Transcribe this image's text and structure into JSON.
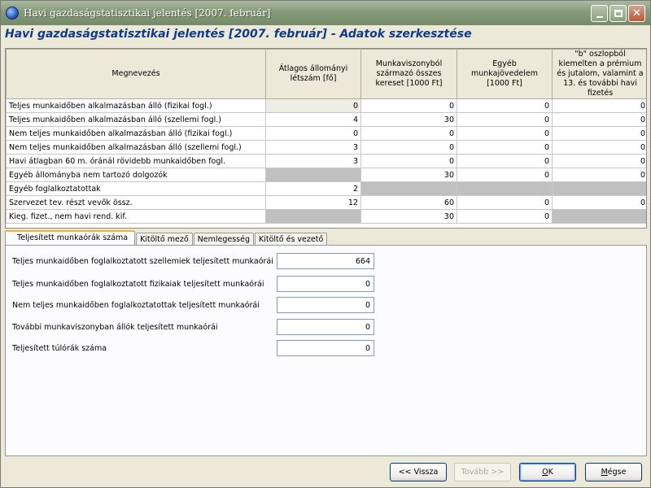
{
  "window": {
    "title": "Havi gazdaságstatisztikai jelentés [2007. február]"
  },
  "header": {
    "title": "Havi gazdaságstatisztikai jelentés [2007. február] - Adatok szerkesztése"
  },
  "grid": {
    "columns": [
      "Megnevezés",
      "Átlagos állományi létszám [fő]",
      "Munkaviszonyból származó összes kereset [1000 Ft]",
      "Egyéb munkajövedelem [1000 Ft]",
      "\"b\" oszlopból kiemelten a prémium és jutalom, valamint a 13. és további havi fizetés"
    ],
    "rows": [
      {
        "label": "Teljes munkaidőben alkalmazásban álló (fizikai fogl.)",
        "cells": [
          "0",
          "0",
          "0",
          "0"
        ],
        "gray": [
          false,
          false,
          false,
          false
        ]
      },
      {
        "label": "Teljes munkaidőben alkalmazásban álló (szellemi fogl.)",
        "cells": [
          "4",
          "30",
          "0",
          "0"
        ],
        "gray": [
          false,
          false,
          false,
          false
        ]
      },
      {
        "label": "Nem teljes munkaidőben alkalmazásban álló (fizikai fogl.)",
        "cells": [
          "0",
          "0",
          "0",
          "0"
        ],
        "gray": [
          false,
          false,
          false,
          false
        ]
      },
      {
        "label": "Nem teljes munkaidőben alkalmazásban álló (szellemi fogl.)",
        "cells": [
          "3",
          "0",
          "0",
          "0"
        ],
        "gray": [
          false,
          false,
          false,
          false
        ]
      },
      {
        "label": "Havi átlagban 60 m. óránál rövidebb munkaidőben fogl.",
        "cells": [
          "3",
          "0",
          "0",
          "0"
        ],
        "gray": [
          false,
          false,
          false,
          false
        ]
      },
      {
        "label": "Egyéb állományba nem tartozó dolgozók",
        "cells": [
          "",
          "30",
          "0",
          "0"
        ],
        "gray": [
          true,
          false,
          false,
          false
        ]
      },
      {
        "label": "Egyéb foglalkoztatottak",
        "cells": [
          "2",
          "",
          "",
          ""
        ],
        "gray": [
          false,
          true,
          true,
          true
        ]
      },
      {
        "label": "Szervezet tev. részt vevők össz.",
        "cells": [
          "12",
          "60",
          "0",
          "0"
        ],
        "gray": [
          false,
          false,
          false,
          false
        ]
      },
      {
        "label": "Kieg. fizet., nem havi rend. kif.",
        "cells": [
          "",
          "30",
          "0",
          ""
        ],
        "gray": [
          true,
          false,
          false,
          true
        ]
      }
    ]
  },
  "tabs": [
    {
      "label": "Teljesített munkaórák száma",
      "active": true
    },
    {
      "label": "Kitöltő mező",
      "active": false
    },
    {
      "label": "Nemlegesség",
      "active": false
    },
    {
      "label": "Kitöltő és vezető",
      "active": false
    }
  ],
  "form": {
    "fields": [
      {
        "label": "Teljes munkaidőben foglalkoztatott szellemiek teljesített munkaórái",
        "value": "664"
      },
      {
        "label": "Teljes munkaidőben foglalkoztatott fizikaiak teljesített munkaórái",
        "value": "0"
      },
      {
        "label": "Nem teljes munkaidőben foglalkoztatottak teljesített munkaórái",
        "value": "0"
      },
      {
        "label": "További munkaviszonyban állók teljesített munkaórái",
        "value": "0"
      },
      {
        "label": "Teljesített túlórák száma",
        "value": "0"
      }
    ]
  },
  "buttons": {
    "back": "<< Vissza",
    "next": "Tovább >>",
    "ok_accel": "O",
    "ok_rest": "K",
    "cancel_accel": "M",
    "cancel_rest": "égse"
  }
}
